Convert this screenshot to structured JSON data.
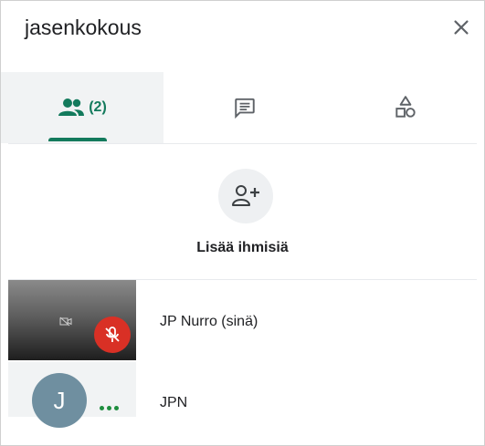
{
  "header": {
    "title": "jasenkokous",
    "close_icon": "close-icon"
  },
  "tabs": [
    {
      "name": "people",
      "icon": "people-icon",
      "count": "(2)",
      "active": true
    },
    {
      "name": "chat",
      "icon": "chat-icon",
      "active": false
    },
    {
      "name": "activities",
      "icon": "activities-icon",
      "active": false
    }
  ],
  "add_people": {
    "icon": "person-add-icon",
    "label": "Lisää ihmisiä"
  },
  "participants": [
    {
      "name": "JP Nurro (sinä)",
      "muted": true,
      "video_off": true
    },
    {
      "name": "JPN",
      "avatar_letter": "J",
      "speaking": true
    }
  ],
  "colors": {
    "accent": "#137a5c",
    "muted_badge": "#d93025",
    "speaking_dots": "#1e8e3e",
    "avatar": "#6f8fa0",
    "tab_active_bg": "#f1f3f4"
  }
}
